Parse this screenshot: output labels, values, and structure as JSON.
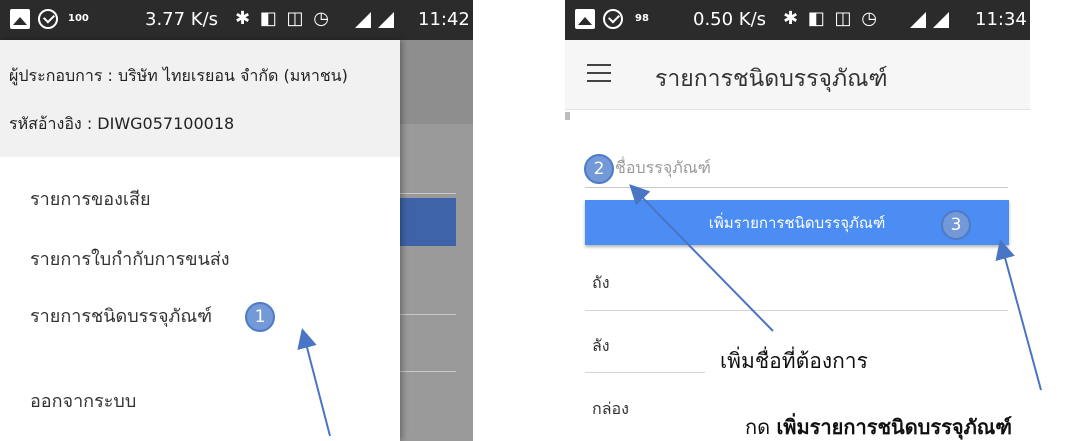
{
  "left_phone": {
    "status": {
      "battery": "100",
      "speed": "3.77 K/s",
      "icons": "✱ ◧ ◫ ◷",
      "time": "11:42"
    },
    "drawer": {
      "operator": "ผู้ประกอบการ : บริษัท ไทยเรยอน จำกัด (มหาชน)",
      "reference": "รหัสอ้างอิง : DIWG057100018",
      "items": [
        {
          "label": "รายการของเสีย"
        },
        {
          "label": "รายการใบกำกับการขนส่ง"
        },
        {
          "label": "รายการชนิดบรรจุภัณฑ์"
        },
        {
          "label": "ออกจากระบบ"
        }
      ]
    }
  },
  "right_phone": {
    "status": {
      "battery": "98",
      "speed": "0.50 K/s",
      "icons": "✱ ◧ ◫ ◷",
      "time": "11:34"
    },
    "toolbar": {
      "title": "รายการชนิดบรรจุภัณฑ์",
      "menu_icon": "hamburger-icon"
    },
    "form": {
      "name_placeholder": "ชื่อบรรจุภัณฑ์",
      "add_button": "เพิ่มรายการชนิดบรรจุภัณฑ์"
    },
    "list": [
      "ถัง",
      "ลัง",
      "กล่อง"
    ]
  },
  "annotations": {
    "step1": "1",
    "step2": "2",
    "step3": "3",
    "note_add_name": "เพิ่มชื่อที่ต้องการ",
    "note_press_prefix": "กด",
    "note_press_bold": "เพิ่มรายการชนิดบรรจุภัณฑ์"
  },
  "colors": {
    "primary_button": "#4b8df3",
    "status_bar": "#2b2b2b",
    "annotation_arrow": "#4a74c4"
  }
}
